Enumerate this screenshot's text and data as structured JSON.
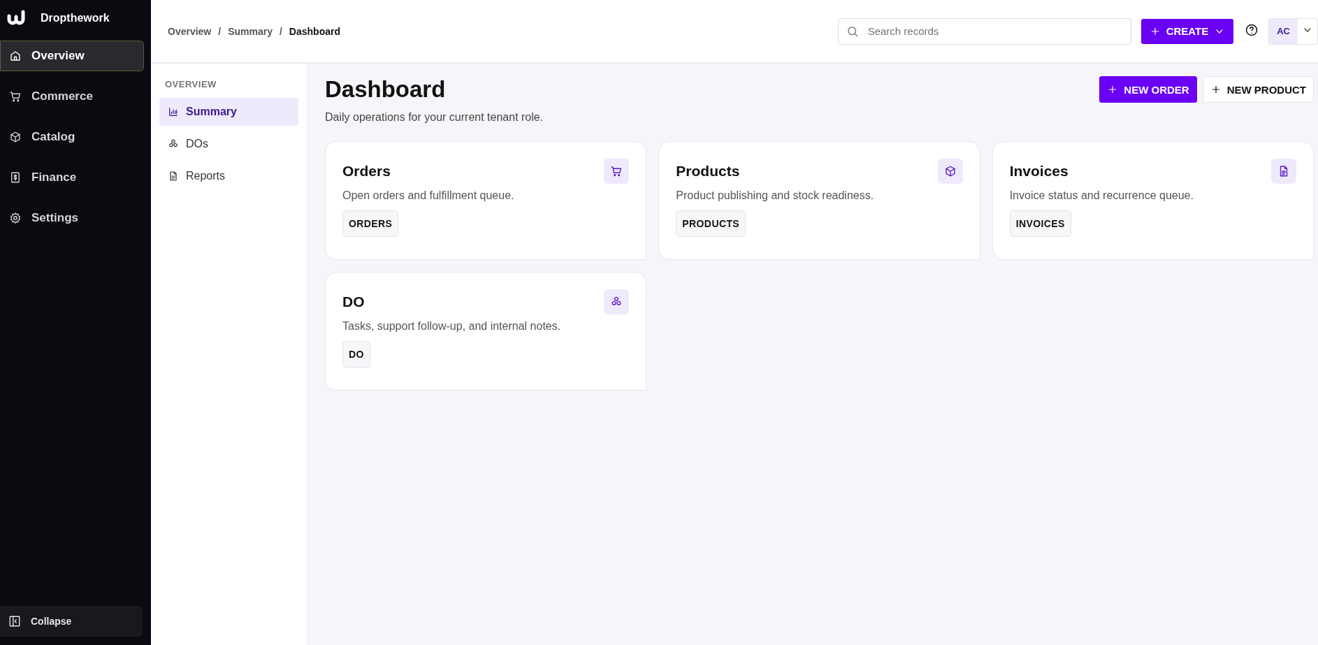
{
  "brand": {
    "name": "Dropthework"
  },
  "sidebar": {
    "items": [
      {
        "label": "Overview",
        "selected": true
      },
      {
        "label": "Commerce",
        "selected": false
      },
      {
        "label": "Catalog",
        "selected": false
      },
      {
        "label": "Finance",
        "selected": false
      },
      {
        "label": "Settings",
        "selected": false
      }
    ],
    "collapse": "Collapse"
  },
  "breadcrumbs": [
    {
      "label": "Overview",
      "current": false
    },
    {
      "label": "Summary",
      "current": false
    },
    {
      "label": "Dashboard",
      "current": true
    }
  ],
  "breadcrumb_separator": "/",
  "search": {
    "placeholder": "Search records"
  },
  "create_button": "CREATE",
  "user": {
    "initials": "AC"
  },
  "subnav": {
    "heading": "OVERVIEW",
    "items": [
      {
        "label": "Summary",
        "selected": true
      },
      {
        "label": "DOs",
        "selected": false
      },
      {
        "label": "Reports",
        "selected": false
      }
    ]
  },
  "page": {
    "title": "Dashboard",
    "subtitle": "Daily operations for your current tenant role.",
    "actions": [
      {
        "label": "NEW ORDER",
        "kind": "primary"
      },
      {
        "label": "NEW PRODUCT",
        "kind": "secondary"
      }
    ]
  },
  "cards": [
    {
      "title": "Orders",
      "description": "Open orders and fulfillment queue.",
      "tag": "ORDERS"
    },
    {
      "title": "Products",
      "description": "Product publishing and stock readiness.",
      "tag": "PRODUCTS"
    },
    {
      "title": "Invoices",
      "description": "Invoice status and recurrence queue.",
      "tag": "INVOICES"
    },
    {
      "title": "DO",
      "description": "Tasks, support follow-up, and internal notes.",
      "tag": "DO"
    }
  ]
}
